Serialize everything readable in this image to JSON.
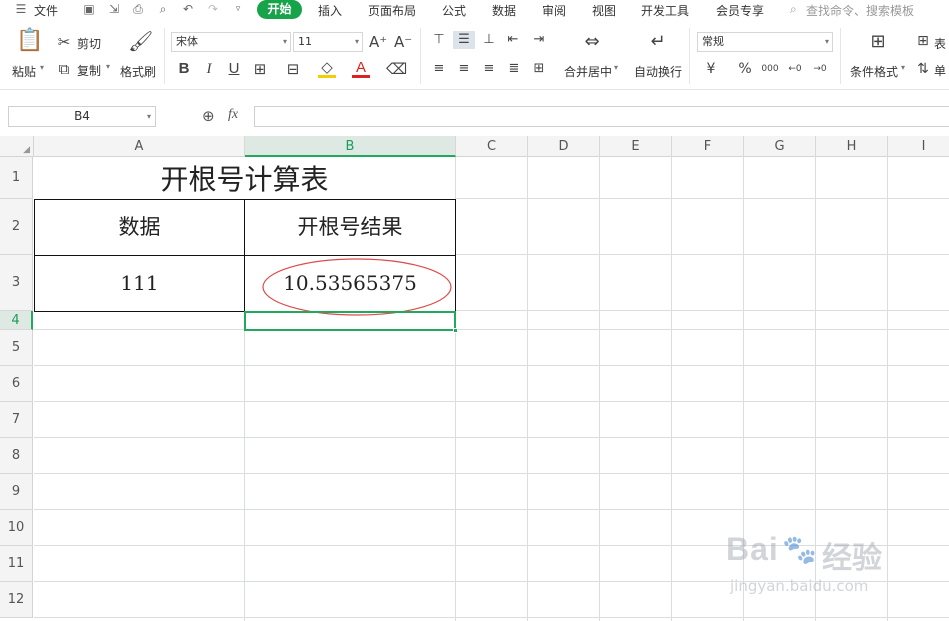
{
  "menubar": {
    "file_label": "文件",
    "tabs": [
      "开始",
      "插入",
      "页面布局",
      "公式",
      "数据",
      "审阅",
      "视图",
      "开发工具",
      "会员专享"
    ],
    "active_tab": "开始",
    "search_placeholder": "查找命令、搜索模板"
  },
  "ribbon": {
    "paste_label": "粘贴",
    "cut_label": "剪切",
    "copy_label": "复制",
    "format_painter_label": "格式刷",
    "font_name": "宋体",
    "font_size": "11",
    "bold_label": "B",
    "italic_label": "I",
    "underline_label": "U",
    "font_color_label": "A",
    "merge_center_label": "合并居中",
    "wrap_text_label": "自动换行",
    "number_format": "常规",
    "currency_label": "¥",
    "percent_label": "%",
    "thousands_label": "000",
    "cond_format_label": "条件格式",
    "table_style_label": "表",
    "cell_label": "单"
  },
  "formula_bar": {
    "name_box": "B4",
    "fx_label": "fx",
    "formula": ""
  },
  "sheet": {
    "columns": [
      "A",
      "B",
      "C",
      "D",
      "E",
      "F",
      "G",
      "H",
      "I"
    ],
    "rows": [
      "1",
      "2",
      "3",
      "4",
      "5",
      "6",
      "7",
      "8",
      "9",
      "10",
      "11",
      "12"
    ],
    "selected_cell": "B4",
    "title": "开根号计算表",
    "header_a": "数据",
    "header_b": "开根号结果",
    "value_a": "111",
    "value_b": "10.53565375",
    "highlight_color": "#e04a4a",
    "selection_color": "#22a95e"
  },
  "watermark": {
    "brand": "Bai",
    "brand_suffix": "经验",
    "url": "jingyan.baidu.com"
  }
}
